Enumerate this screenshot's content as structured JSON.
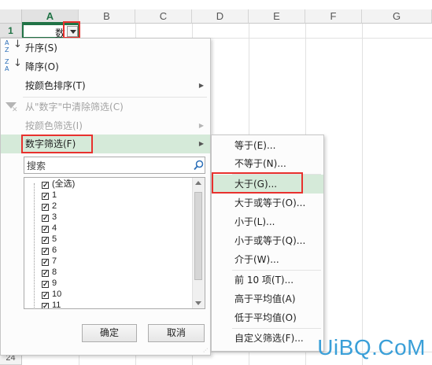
{
  "grid": {
    "columns": [
      "A",
      "B",
      "C",
      "D",
      "E",
      "F",
      "G"
    ],
    "rows": [
      "1",
      "24"
    ],
    "cell_a1": "数"
  },
  "menu": {
    "items": [
      {
        "label": "升序(S)",
        "icon": "sort-ascending-icon",
        "disabled": false
      },
      {
        "label": "降序(O)",
        "icon": "sort-descending-icon",
        "disabled": false
      },
      {
        "label": "按颜色排序(T)",
        "disabled": false,
        "submenu": true
      },
      {
        "label": "从\"数字\"中清除筛选(C)",
        "icon": "clear-filter-icon",
        "disabled": true
      },
      {
        "label": "按颜色筛选(I)",
        "disabled": true,
        "submenu": true
      },
      {
        "label": "数字筛选(F)",
        "disabled": false,
        "submenu": true,
        "highlighted": true
      }
    ],
    "search_placeholder": "搜索",
    "list": [
      "(全选)",
      "1",
      "2",
      "3",
      "4",
      "5",
      "6",
      "7",
      "8",
      "9",
      "10",
      "11"
    ],
    "ok_label": "确定",
    "cancel_label": "取消"
  },
  "submenu": {
    "items": [
      "等于(E)...",
      "不等于(N)...",
      "大于(G)...",
      "大于或等于(O)...",
      "小于(L)...",
      "小于或等于(Q)...",
      "介于(W)...",
      "前 10 项(T)...",
      "高于平均值(A)",
      "低于平均值(O)",
      "自定义筛选(F)..."
    ],
    "highlighted_index": 2
  },
  "watermark": "UiBQ.CoM",
  "colors": {
    "accent_green": "#217346",
    "highlight": "#d5ead9",
    "annotation_red": "#e8312e",
    "watermark_blue": "#3a9fd8"
  }
}
